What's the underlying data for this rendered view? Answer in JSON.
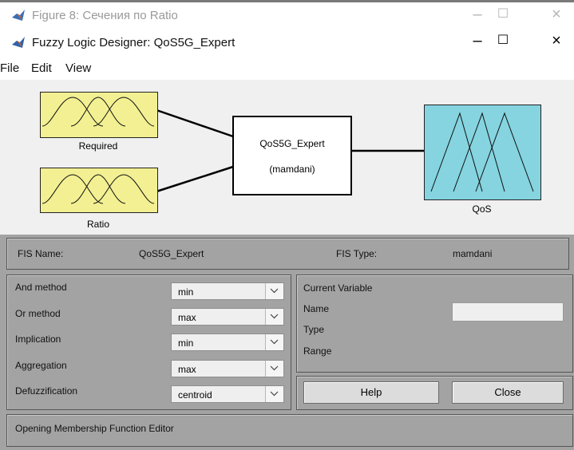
{
  "back_window": {
    "title": "Figure 8: Сечения по Ratio"
  },
  "window": {
    "title": "Fuzzy Logic Designer: QoS5G_Expert"
  },
  "menu": [
    "File",
    "Edit",
    "View"
  ],
  "diagram": {
    "inputs": [
      {
        "name": "Required"
      },
      {
        "name": "Ratio"
      }
    ],
    "system": {
      "name": "QoS5G_Expert",
      "type": "(mamdani)"
    },
    "output": {
      "name": "QoS"
    }
  },
  "fis_info": {
    "name_label": "FIS Name:",
    "name_value": "QoS5G_Expert",
    "type_label": "FIS Type:",
    "type_value": "mamdani"
  },
  "methods": [
    {
      "label": "And method",
      "value": "min"
    },
    {
      "label": "Or method",
      "value": "max"
    },
    {
      "label": "Implication",
      "value": "min"
    },
    {
      "label": "Aggregation",
      "value": "max"
    },
    {
      "label": "Defuzzification",
      "value": "centroid"
    }
  ],
  "current_variable": {
    "title": "Current Variable",
    "name_label": "Name",
    "type_label": "Type",
    "range_label": "Range",
    "name_value": ""
  },
  "buttons": {
    "help": "Help",
    "close": "Close"
  },
  "status": "Opening Membership Function Editor",
  "colors": {
    "input_box": "#f2f092",
    "output_box": "#85d4e0",
    "panel": "#a3a3a3"
  }
}
